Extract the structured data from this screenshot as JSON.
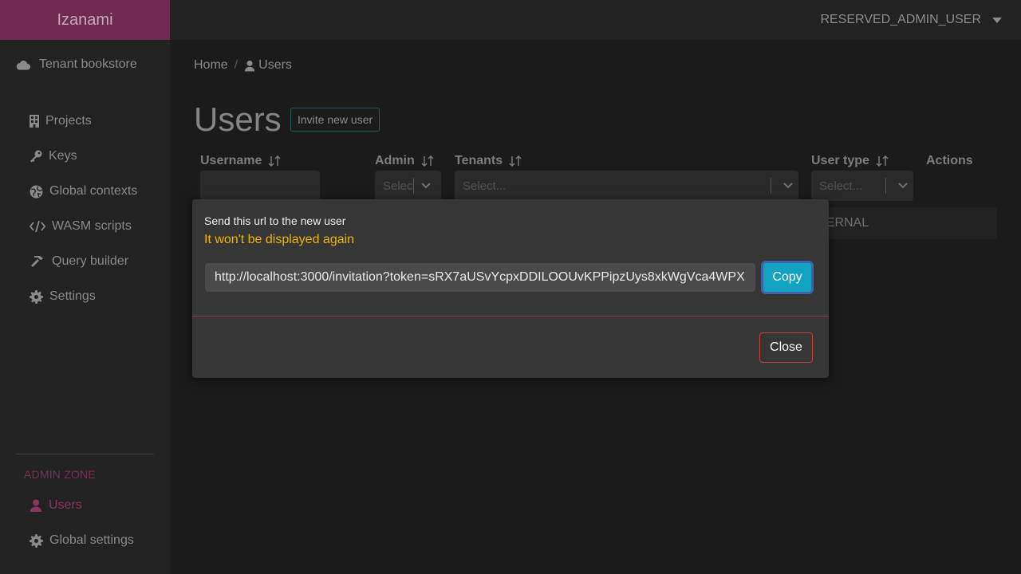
{
  "app": {
    "brand": "Izanami",
    "user": "RESERVED_ADMIN_USER"
  },
  "sidebar": {
    "tenant": "Tenant bookstore",
    "items": [
      {
        "label": "Projects",
        "icon": "building-icon"
      },
      {
        "label": "Keys",
        "icon": "key-icon"
      },
      {
        "label": "Global contexts",
        "icon": "globe-icon"
      },
      {
        "label": "WASM scripts",
        "icon": "code-icon"
      },
      {
        "label": "Query builder",
        "icon": "hammer-icon"
      },
      {
        "label": "Settings",
        "icon": "gear-icon"
      }
    ],
    "admin_title": "ADMIN ZONE",
    "admin_items": [
      {
        "label": "Users",
        "icon": "user-icon",
        "active": true
      },
      {
        "label": "Global settings",
        "icon": "gear-icon"
      }
    ]
  },
  "breadcrumb": {
    "home": "Home",
    "current": "Users"
  },
  "page": {
    "title": "Users",
    "invite_label": "Invite new user"
  },
  "table": {
    "columns": {
      "username": "Username",
      "admin": "Admin",
      "tenants": "Tenants",
      "user_type": "User type",
      "actions": "Actions"
    },
    "filters": {
      "admin_placeholder": "Select...",
      "tenants_placeholder": "Select...",
      "user_type_placeholder": "Select..."
    },
    "row_partial": "TERNAL"
  },
  "modal": {
    "title": "Send this url to the new user",
    "warning": "It won't be displayed again",
    "url": "http://localhost:3000/invitation?token=sRX7aUSvYcpxDDILOOUvKPPipzUys8xkWgVca4WPX",
    "copy_label": "Copy",
    "close_label": "Close"
  },
  "colors": {
    "brand": "#6e2a4f",
    "accent": "#8e3462",
    "copy": "#12a3c2",
    "warning": "#f0b400",
    "danger": "#c0413e"
  }
}
